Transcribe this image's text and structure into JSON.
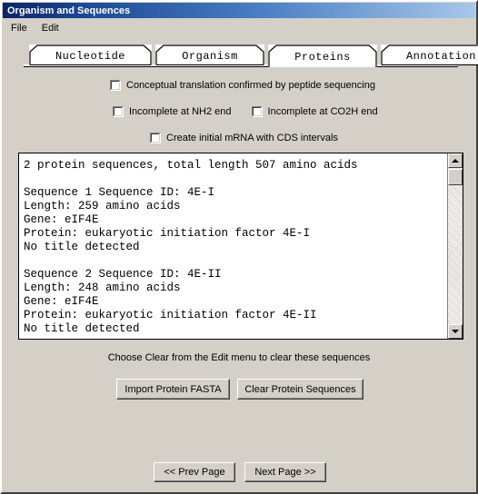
{
  "window": {
    "title": "Organism and Sequences"
  },
  "menubar": {
    "items": [
      {
        "label": "File"
      },
      {
        "label": "Edit"
      }
    ]
  },
  "tabs": {
    "items": [
      {
        "label": "Nucleotide",
        "selected": false
      },
      {
        "label": "Organism",
        "selected": false
      },
      {
        "label": "Proteins",
        "selected": true
      },
      {
        "label": "Annotation",
        "selected": false
      }
    ]
  },
  "options": {
    "row1": [
      {
        "label": "Conceptual translation confirmed by peptide sequencing",
        "checked": false
      }
    ],
    "row2": [
      {
        "label": "Incomplete at NH2 end",
        "checked": false
      },
      {
        "label": "Incomplete at CO2H end",
        "checked": false
      }
    ],
    "row3": [
      {
        "label": "Create initial mRNA with CDS intervals",
        "checked": false
      }
    ]
  },
  "sequence_view": {
    "text": "2 protein sequences, total length 507 amino acids\n\nSequence 1 Sequence ID: 4E-I\nLength: 259 amino acids\nGene: eIF4E\nProtein: eukaryotic initiation factor 4E-I\nNo title detected\n\nSequence 2 Sequence ID: 4E-II\nLength: 248 amino acids\nGene: eIF4E\nProtein: eukaryotic initiation factor 4E-II\nNo title detected"
  },
  "hint": {
    "text": "Choose Clear from the Edit menu to clear these sequences"
  },
  "actions": {
    "import_label": "Import Protein FASTA",
    "clear_label": "Clear Protein Sequences"
  },
  "nav": {
    "prev_label": "<< Prev Page",
    "next_label": "Next Page >>"
  },
  "colors": {
    "face": "#d4d0c8",
    "title_start": "#0a246a",
    "title_end": "#a6c8ea",
    "field_bg": "#ffffff",
    "text": "#000000"
  }
}
